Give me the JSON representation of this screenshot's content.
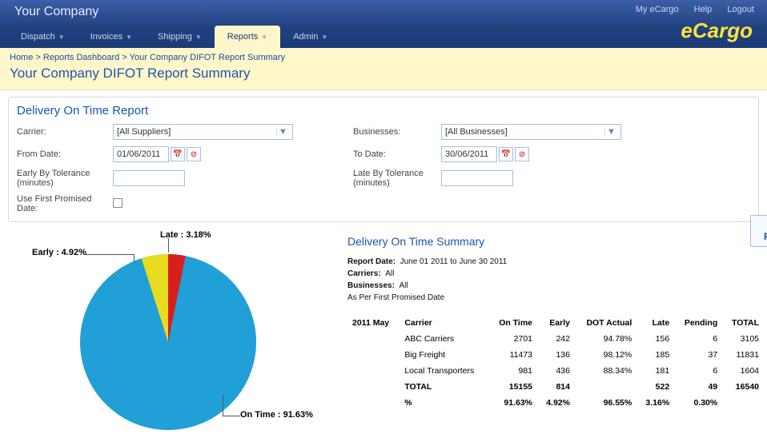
{
  "header": {
    "company": "Your Company",
    "links": {
      "myecargo": "My eCargo",
      "help": "Help",
      "logout": "Logout"
    },
    "nav": {
      "dispatch": "Dispatch",
      "invoices": "Invoices",
      "shipping": "Shipping",
      "reports": "Reports",
      "admin": "Admin"
    },
    "logo_e": "e",
    "logo_rest": "Cargo"
  },
  "crumbs": {
    "home": "Home",
    "sep": ">",
    "dashboard": "Reports Dashboard",
    "current": "Your Company DIFOT Report Summary",
    "title": "Your Company DIFOT Report Summary"
  },
  "filters": {
    "panel_title": "Delivery On Time Report",
    "carrier_label": "Carrier:",
    "carrier_value": "[All Suppliers]",
    "business_label": "Businesses:",
    "business_value": "[All Businesses]",
    "from_label": "From Date:",
    "from_value": "01/06/2011",
    "to_label": "To Date:",
    "to_value": "30/06/2011",
    "early_label": "Early By Tolerance (minutes)",
    "late_label": "Late By Tolerance (minutes)",
    "usefirst_label": "Use First Promised Date:",
    "view_btn": "View Report"
  },
  "chart_labels": {
    "late": "Late : 3.18%",
    "early": "Early : 4.92%",
    "ontime": "On Time : 91.63%"
  },
  "chart_data": {
    "type": "pie",
    "title": "Delivery On Time",
    "series": [
      {
        "name": "On Time",
        "value": 91.63,
        "color": "#219fd7"
      },
      {
        "name": "Early",
        "value": 4.92,
        "color": "#e8dc1f"
      },
      {
        "name": "Late",
        "value": 3.18,
        "color": "#d81f1f"
      }
    ]
  },
  "summary": {
    "title": "Delivery On Time Summary",
    "report_date_label": "Report Date:",
    "report_date_value": "June 01 2011 to June 30 2011",
    "carriers_label": "Carriers:",
    "carriers_value": "All",
    "businesses_label": "Businesses:",
    "businesses_value": "All",
    "asper": "As Per First Promised Date"
  },
  "table": {
    "period": "2011 May",
    "headers": {
      "carrier": "Carrier",
      "ontime": "On Time",
      "early": "Early",
      "dot": "DOT Actual",
      "late": "Late",
      "pending": "Pending",
      "total": "TOTAL"
    },
    "rows": [
      {
        "carrier": "ABC Carriers",
        "ontime": "2701",
        "early": "242",
        "dot": "94.78%",
        "late": "156",
        "pending": "6",
        "total": "3105"
      },
      {
        "carrier": "Big Freight",
        "ontime": "11473",
        "early": "136",
        "dot": "98.12%",
        "late": "185",
        "pending": "37",
        "total": "11831"
      },
      {
        "carrier": "Local Transporters",
        "ontime": "981",
        "early": "436",
        "dot": "88.34%",
        "late": "181",
        "pending": "6",
        "total": "1604"
      }
    ],
    "total": {
      "label": "TOTAL",
      "ontime": "15155",
      "early": "814",
      "dot": "",
      "late": "522",
      "pending": "49",
      "total": "16540"
    },
    "pct": {
      "label": "%",
      "ontime": "91.63%",
      "early": "4.92%",
      "dot": "96.55%",
      "late": "3.16%",
      "pending": "0.30%",
      "total": ""
    }
  }
}
